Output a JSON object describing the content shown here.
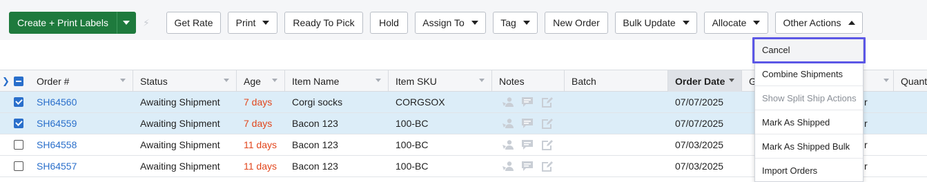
{
  "toolbar": {
    "primary_label": "Create + Print Labels",
    "buttons": {
      "get_rate": "Get Rate",
      "print": "Print",
      "ready_to_pick": "Ready To Pick",
      "hold": "Hold",
      "assign_to": "Assign To",
      "tag": "Tag",
      "new_order": "New Order",
      "bulk_update": "Bulk Update",
      "allocate": "Allocate",
      "other_actions": "Other Actions"
    }
  },
  "table": {
    "columns": {
      "order": "Order #",
      "status": "Status",
      "age": "Age",
      "item_name": "Item Name",
      "item_sku": "Item SKU",
      "notes": "Notes",
      "batch": "Batch",
      "order_date": "Order Date",
      "g": "G",
      "quant": "Quant"
    },
    "rows": [
      {
        "order": "SH64560",
        "status": "Awaiting Shipment",
        "age": "7 days",
        "item_name": "Corgi socks",
        "item_sku": "CORGSOX",
        "order_date": "07/07/2025",
        "tail": "r"
      },
      {
        "order": "SH64559",
        "status": "Awaiting Shipment",
        "age": "7 days",
        "item_name": "Bacon 123",
        "item_sku": "100-BC",
        "order_date": "07/07/2025",
        "tail": "r"
      },
      {
        "order": "SH64558",
        "status": "Awaiting Shipment",
        "age": "11 days",
        "item_name": "Bacon 123",
        "item_sku": "100-BC",
        "order_date": "07/03/2025",
        "tail": "r"
      },
      {
        "order": "SH64557",
        "status": "Awaiting Shipment",
        "age": "11 days",
        "item_name": "Bacon 123",
        "item_sku": "100-BC",
        "order_date": "07/03/2025",
        "tail": "r"
      }
    ],
    "selected_rows": [
      0,
      1
    ]
  },
  "other_actions_menu": {
    "items": [
      "Cancel",
      "Combine Shipments",
      "Show Split Ship Actions",
      "Mark As Shipped",
      "Mark As Shipped Bulk",
      "Import Orders"
    ]
  },
  "colors": {
    "primary": "#1e7a3d",
    "link": "#2a6fcb",
    "age": "#e2461c",
    "selected_row": "#dcedf8",
    "highlight": "#5b57e6"
  }
}
